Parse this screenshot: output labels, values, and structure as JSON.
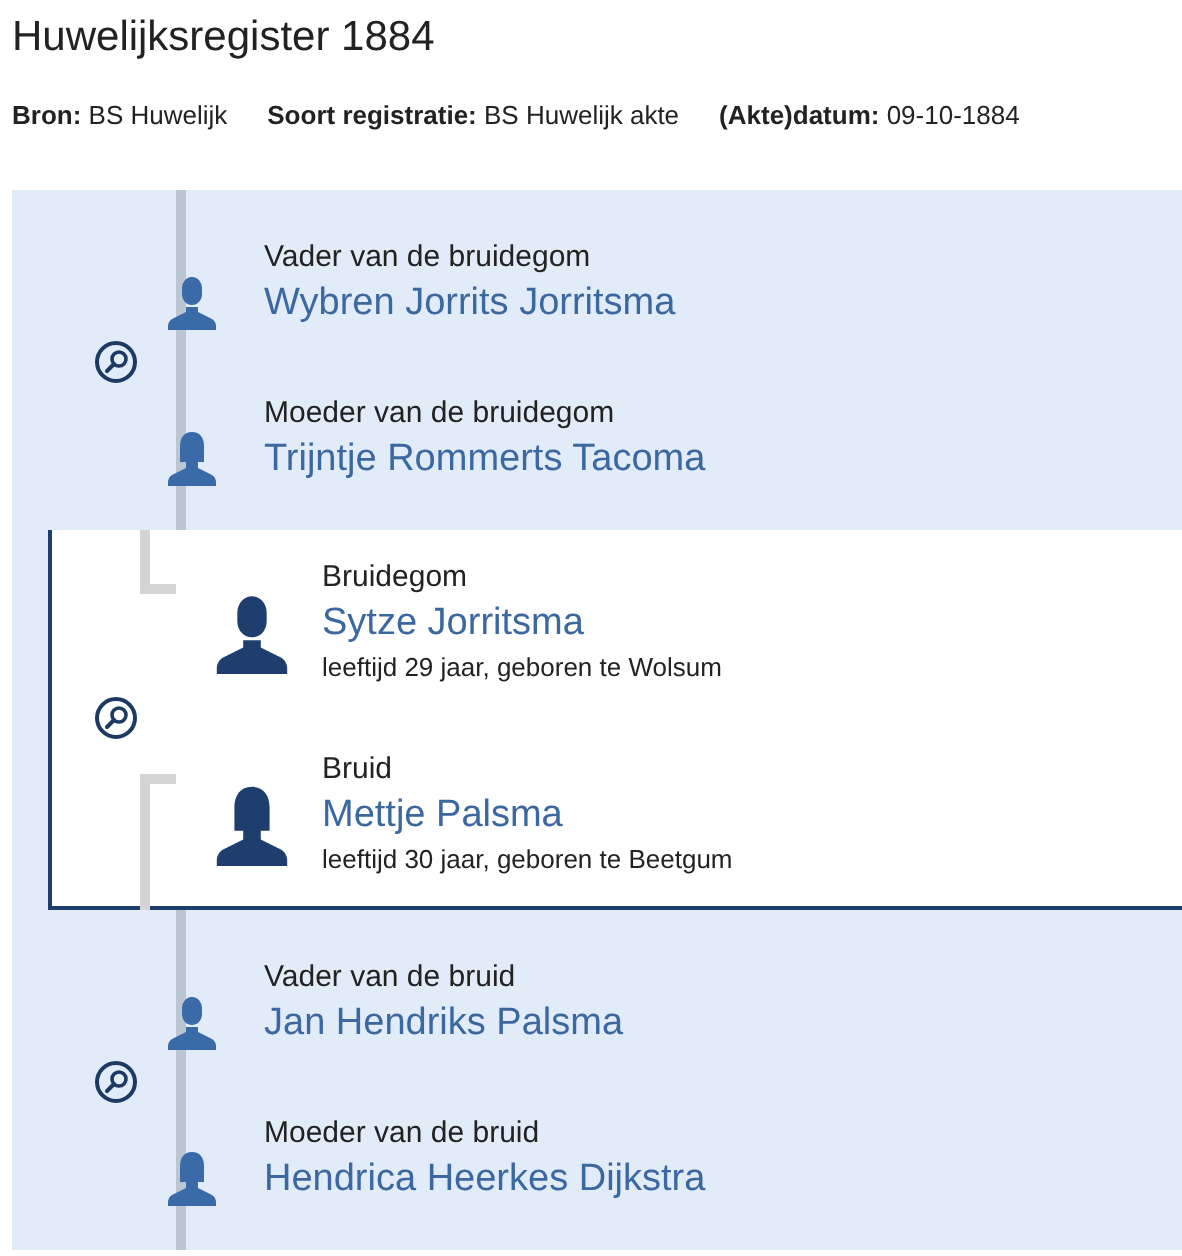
{
  "title": "Huwelijksregister 1884",
  "meta": [
    {
      "label": "Bron:",
      "value": "BS Huwelijk"
    },
    {
      "label": "Soort registratie:",
      "value": "BS Huwelijk akte"
    },
    {
      "label": "(Akte)datum:",
      "value": "09-10-1884"
    }
  ],
  "groups": [
    {
      "kind": "parents",
      "persons": [
        {
          "role": "Vader van de bruidegom",
          "name": "Wybren Jorrits Jorritsma",
          "kind": "male"
        },
        {
          "role": "Moeder van de bruidegom",
          "name": "Trijntje Rommerts Tacoma",
          "kind": "female"
        }
      ]
    },
    {
      "kind": "couple",
      "persons": [
        {
          "role": "Bruidegom",
          "name": "Sytze Jorritsma",
          "details": "leeftijd 29 jaar, geboren te Wolsum",
          "kind": "male"
        },
        {
          "role": "Bruid",
          "name": "Mettje Palsma",
          "details": "leeftijd 30 jaar, geboren te Beetgum",
          "kind": "female"
        }
      ]
    },
    {
      "kind": "parents",
      "persons": [
        {
          "role": "Vader van de bruid",
          "name": "Jan Hendriks Palsma",
          "kind": "male"
        },
        {
          "role": "Moeder van de bruid",
          "name": "Hendrica Heerkes Dijkstra",
          "kind": "female"
        }
      ]
    }
  ]
}
